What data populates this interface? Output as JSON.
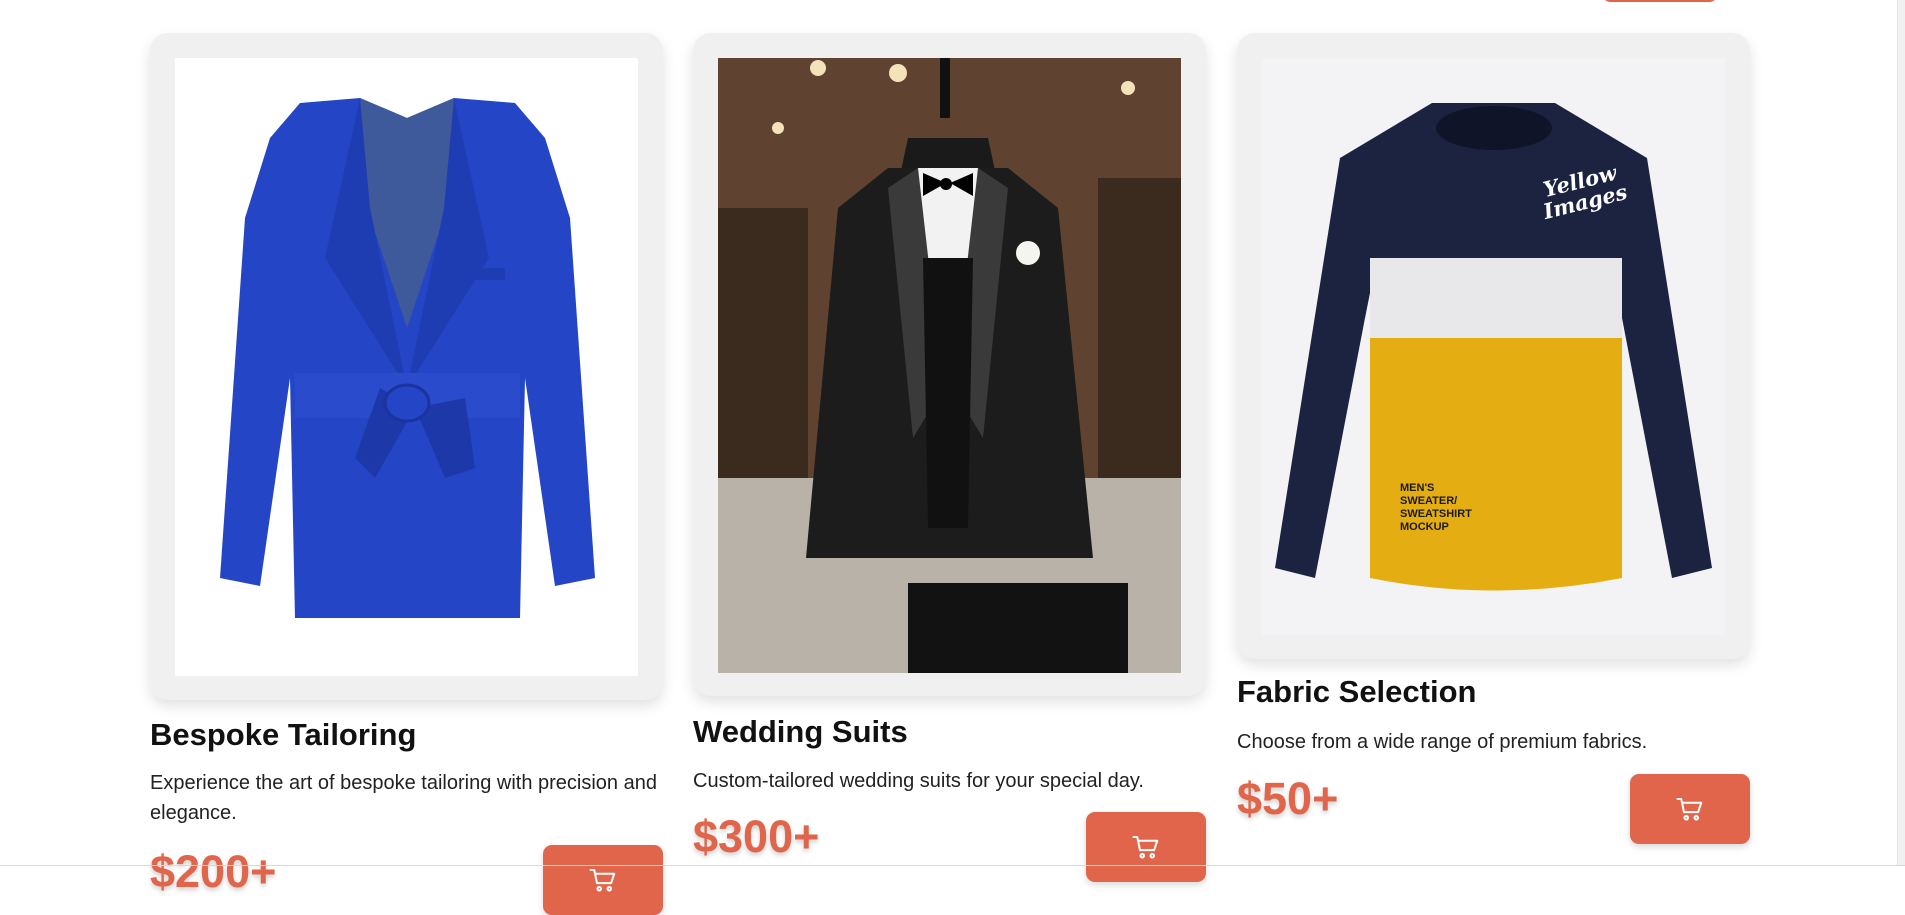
{
  "colors": {
    "accent": "#e0654a",
    "card_bg": "#f0f0f0",
    "text": "#111111"
  },
  "products": [
    {
      "title": "Bespoke Tailoring",
      "description": "Experience the art of bespoke tailoring with precision and elegance.",
      "price": "$200+",
      "image": "royal-blue-shawl-collar-belted-blazer",
      "cart_icon": "cart-icon"
    },
    {
      "title": "Wedding Suits",
      "description": "Custom-tailored wedding suits for your special day.",
      "price": "$300+",
      "image": "black-tuxedo-on-mannequin",
      "cart_icon": "cart-icon"
    },
    {
      "title": "Fabric Selection",
      "description": "Choose from a wide range of premium fabrics.",
      "price": "$50+",
      "image": "navy-white-yellow-sweatshirt",
      "cart_icon": "cart-icon"
    }
  ],
  "image_text": {
    "sweatshirt_logo_1": "Yellow",
    "sweatshirt_logo_2": "Images",
    "sweatshirt_print": [
      "MEN'S",
      "SWEATER/",
      "SWEATSHIRT",
      "MOCKUP"
    ]
  }
}
